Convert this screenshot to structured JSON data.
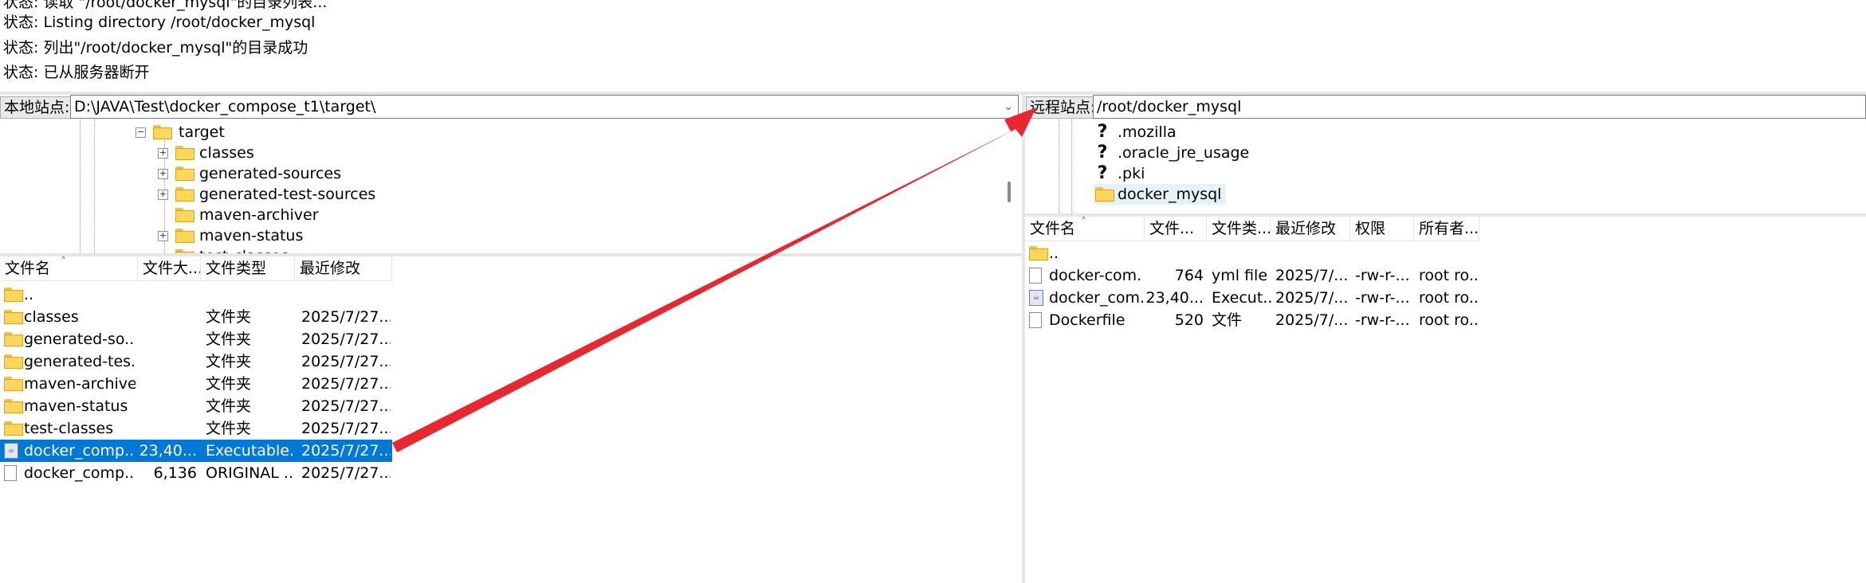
{
  "colors": {
    "selection": "#0078d7",
    "arrow": "#e8282e",
    "folder": "#ffd65c"
  },
  "log": [
    "状态: 读取 \"/root/docker_mysql\"的目录列表...",
    "状态: Listing directory /root/docker_mysql",
    "状态: 列出\"/root/docker_mysql\"的目录成功",
    "状态: 已从服务器断开"
  ],
  "local": {
    "site_label": "本地站点:",
    "path": "D:\\JAVA\\Test\\docker_compose_t1\\target\\",
    "tree": {
      "root": "target",
      "children": [
        "classes",
        "generated-sources",
        "generated-test-sources",
        "maven-archiver",
        "maven-status",
        "test-classes"
      ]
    },
    "columns": [
      "文件名",
      "文件大...",
      "文件类型",
      "最近修改"
    ],
    "rows": [
      {
        "name": "..",
        "size": "",
        "type": "",
        "modified": "",
        "icon": "folder-icon"
      },
      {
        "name": "classes",
        "size": "",
        "type": "文件夹",
        "modified": "2025/7/27...",
        "icon": "folder-icon"
      },
      {
        "name": "generated-so...",
        "size": "",
        "type": "文件夹",
        "modified": "2025/7/27...",
        "icon": "folder-icon"
      },
      {
        "name": "generated-tes...",
        "size": "",
        "type": "文件夹",
        "modified": "2025/7/27...",
        "icon": "folder-icon"
      },
      {
        "name": "maven-archiver",
        "size": "",
        "type": "文件夹",
        "modified": "2025/7/27...",
        "icon": "folder-icon"
      },
      {
        "name": "maven-status",
        "size": "",
        "type": "文件夹",
        "modified": "2025/7/27...",
        "icon": "folder-icon"
      },
      {
        "name": "test-classes",
        "size": "",
        "type": "文件夹",
        "modified": "2025/7/27...",
        "icon": "folder-icon"
      },
      {
        "name": "docker_comp...",
        "size": "23,40...",
        "type": "Executable...",
        "modified": "2025/7/27...",
        "icon": "jar-icon",
        "selected": true
      },
      {
        "name": "docker_comp...",
        "size": "6,136",
        "type": "ORIGINAL ...",
        "modified": "2025/7/27...",
        "icon": "file-icon"
      }
    ]
  },
  "remote": {
    "site_label": "远程站点:",
    "path": "/root/docker_mysql",
    "tree": [
      {
        "name": ".mozilla",
        "icon": "unknown-folder-icon"
      },
      {
        "name": ".oracle_jre_usage",
        "icon": "unknown-folder-icon"
      },
      {
        "name": ".pki",
        "icon": "unknown-folder-icon"
      },
      {
        "name": "docker_mysql",
        "icon": "folder-icon"
      }
    ],
    "columns": [
      "文件名",
      "文件...",
      "文件类...",
      "最近修改",
      "权限",
      "所有者..."
    ],
    "rows": [
      {
        "name": "..",
        "size": "",
        "type": "",
        "modified": "",
        "perms": "",
        "owner": "",
        "icon": "folder-icon"
      },
      {
        "name": "docker-com...",
        "size": "764",
        "type": "yml file",
        "modified": "2025/7/...",
        "perms": "-rw-r-...",
        "owner": "root ro...",
        "icon": "file-icon"
      },
      {
        "name": "docker_com...",
        "size": "23,40...",
        "type": "Execut...",
        "modified": "2025/7/...",
        "perms": "-rw-r-...",
        "owner": "root ro...",
        "icon": "jar-icon"
      },
      {
        "name": "Dockerfile",
        "size": "520",
        "type": "文件",
        "modified": "2025/7/...",
        "perms": "-rw-r-...",
        "owner": "root ro...",
        "icon": "file-icon"
      }
    ]
  }
}
